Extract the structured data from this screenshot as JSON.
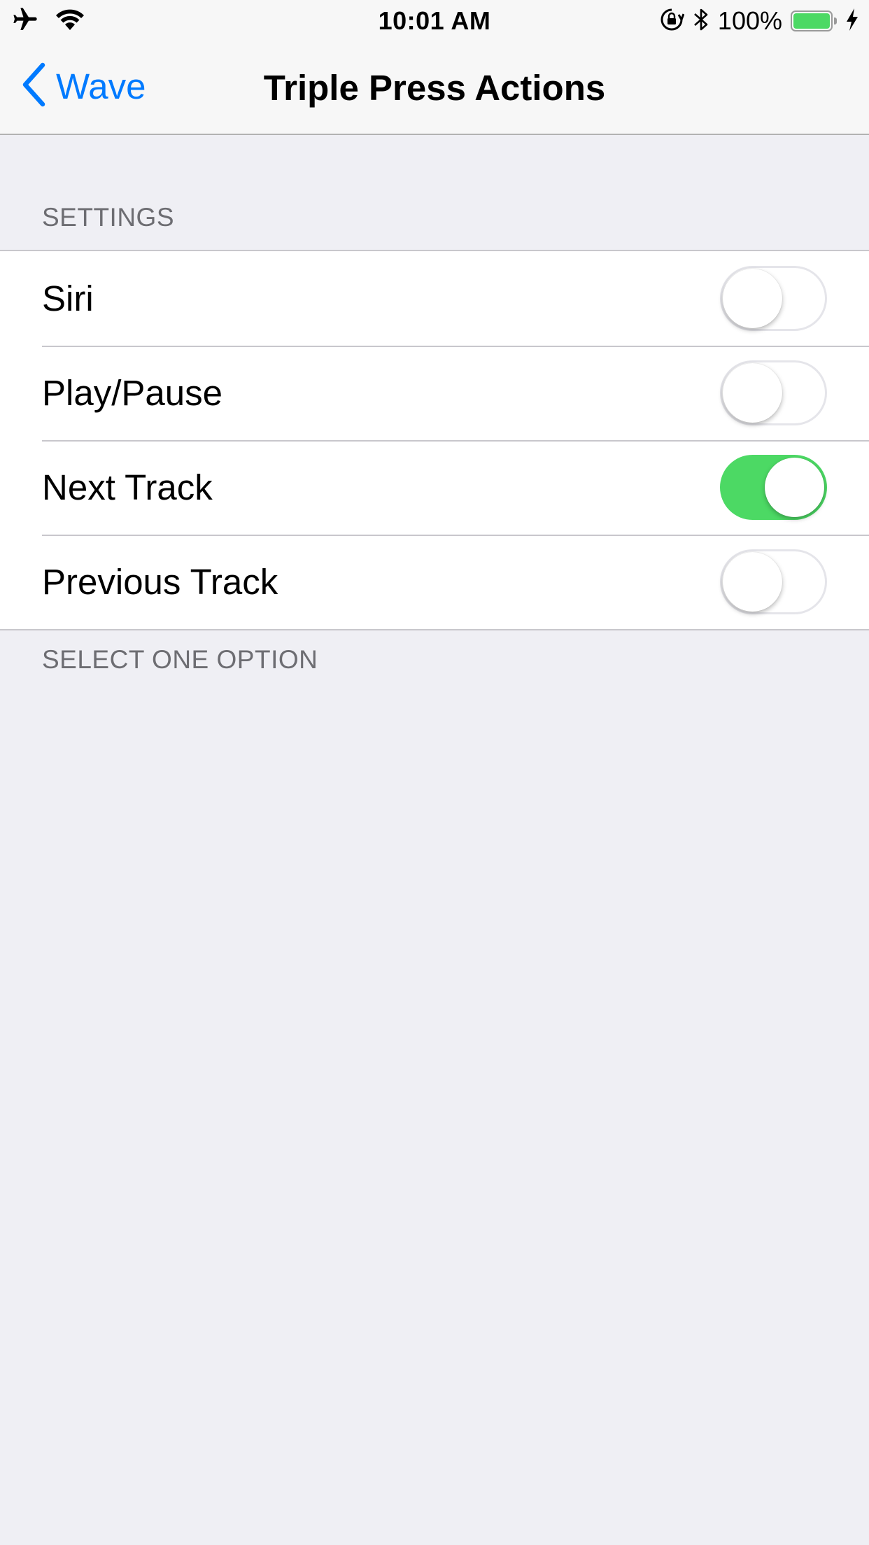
{
  "status_bar": {
    "time": "10:01 AM",
    "battery_percent": "100%",
    "battery_level": 1.0,
    "battery_color": "#4cd964",
    "icons": [
      "airplane-icon",
      "wifi-icon",
      "orientation-lock-icon",
      "bluetooth-icon",
      "battery-icon",
      "charging-bolt-icon"
    ]
  },
  "nav": {
    "back_label": "Wave",
    "title": "Triple Press Actions",
    "accent_color": "#007aff"
  },
  "section": {
    "header": "SETTINGS",
    "footer": "SELECT ONE OPTION",
    "rows": [
      {
        "label": "Siri",
        "enabled": false
      },
      {
        "label": "Play/Pause",
        "enabled": false
      },
      {
        "label": "Next Track",
        "enabled": true
      },
      {
        "label": "Previous Track",
        "enabled": false
      }
    ]
  },
  "colors": {
    "toggle_on": "#4cd964",
    "background": "#efeff4"
  }
}
